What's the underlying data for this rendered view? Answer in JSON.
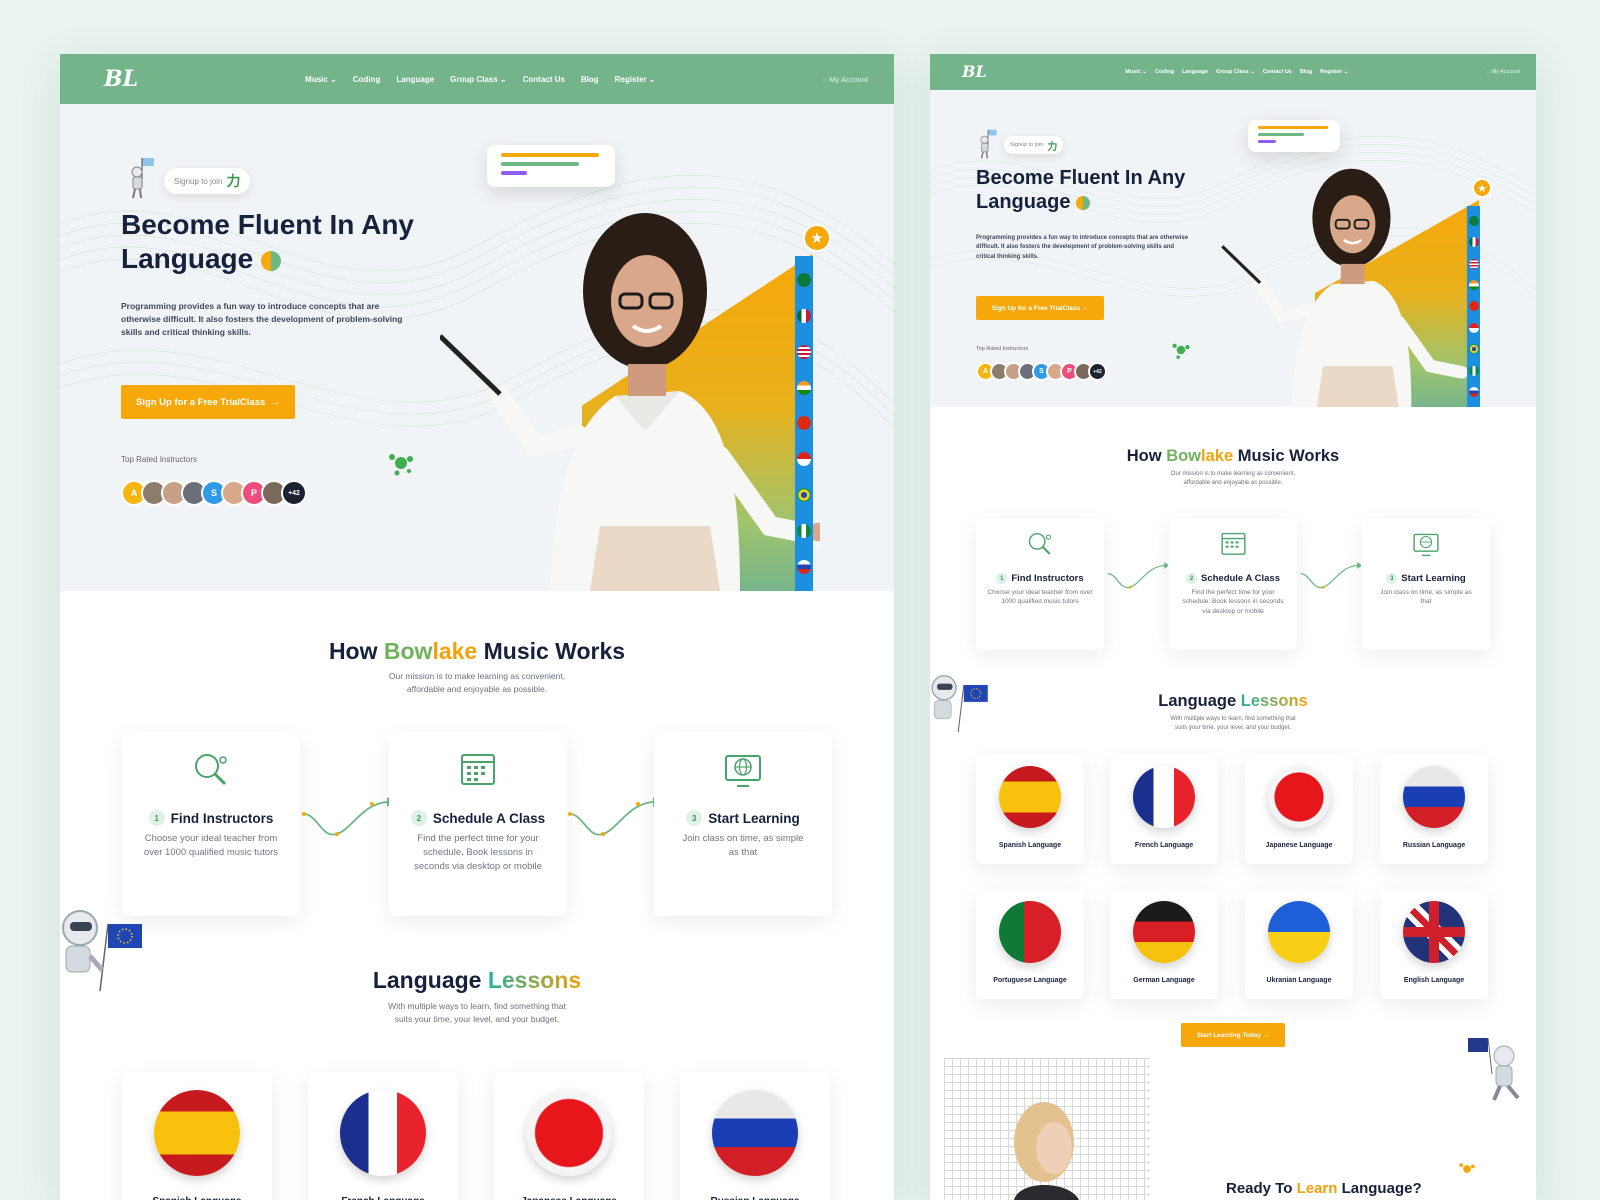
{
  "nav": {
    "logo": "BL",
    "items": [
      "Music ⌄",
      "Coding",
      "Language",
      "Group Class ⌄",
      "Contact Us",
      "Blog",
      "Register ⌄"
    ],
    "account": "My Account"
  },
  "hero": {
    "signup_pill": "Signup to join",
    "signup_char": "力",
    "title_line1": "Become Fluent In Any",
    "title_line2": "Language",
    "description": "Programming provides a fun way to introduce concepts that are otherwise difficult. It also fosters the development of problem-solving skills and critical thinking skills.",
    "cta": "Sign Up for a Free TrialClass",
    "cta_arrow": "→",
    "top_rated": "Top Rated Instructors",
    "avatars": [
      {
        "label": "A",
        "color": "#f6b60f"
      },
      {
        "label": "",
        "color": "#8d7b6b"
      },
      {
        "label": "",
        "color": "#c79f84"
      },
      {
        "label": "",
        "color": "#6b6f7a"
      },
      {
        "label": "S",
        "color": "#2f9be6"
      },
      {
        "label": "",
        "color": "#d7a98a"
      },
      {
        "label": "P",
        "color": "#ee4c7a"
      },
      {
        "label": "",
        "color": "#7b6a5c"
      },
      {
        "label": "+42",
        "color": "#1d2233"
      }
    ],
    "star": "★"
  },
  "how": {
    "title_a": "How ",
    "title_b": "Bowlake",
    "title_c": " Music Works",
    "subtitle_line1": "Our mission is to make learning as convenient,",
    "subtitle_line2": "affordable and enjoyable as possible.",
    "steps": [
      {
        "num": "1",
        "title": "Find Instructors",
        "desc": "Choose your ideal teacher from over 1000 qualified music tutors",
        "icon": "search-icon"
      },
      {
        "num": "2",
        "title": "Schedule A Class",
        "desc": "Find the perfect time for your schedule. Book lessons in seconds via desktop or mobile",
        "icon": "calendar-icon"
      },
      {
        "num": "3",
        "title": "Start Learning",
        "desc": "Join class on time, as simple as that",
        "icon": "globe-monitor-icon"
      }
    ]
  },
  "lessons": {
    "title_a": "Language ",
    "title_b": "Lessons",
    "subtitle_line1": "With multiple ways to learn, find something that",
    "subtitle_line2": "suits your time, your level, and your budget.",
    "languages": [
      {
        "label": "Spanish Language",
        "flag": "spain"
      },
      {
        "label": "French Language",
        "flag": "france"
      },
      {
        "label": "Japanese Language",
        "flag": "japan"
      },
      {
        "label": "Russian Language",
        "flag": "russia"
      },
      {
        "label": "Portuguese Language",
        "flag": "portugal"
      },
      {
        "label": "German Language",
        "flag": "germany"
      },
      {
        "label": "Ukranian Language",
        "flag": "ukraine"
      },
      {
        "label": "English Language",
        "flag": "uk"
      }
    ],
    "start_button": "Start Learning Today",
    "start_arrow": "→"
  },
  "ready": {
    "a": "Ready To ",
    "b": "Learn",
    "c": " Language?"
  }
}
